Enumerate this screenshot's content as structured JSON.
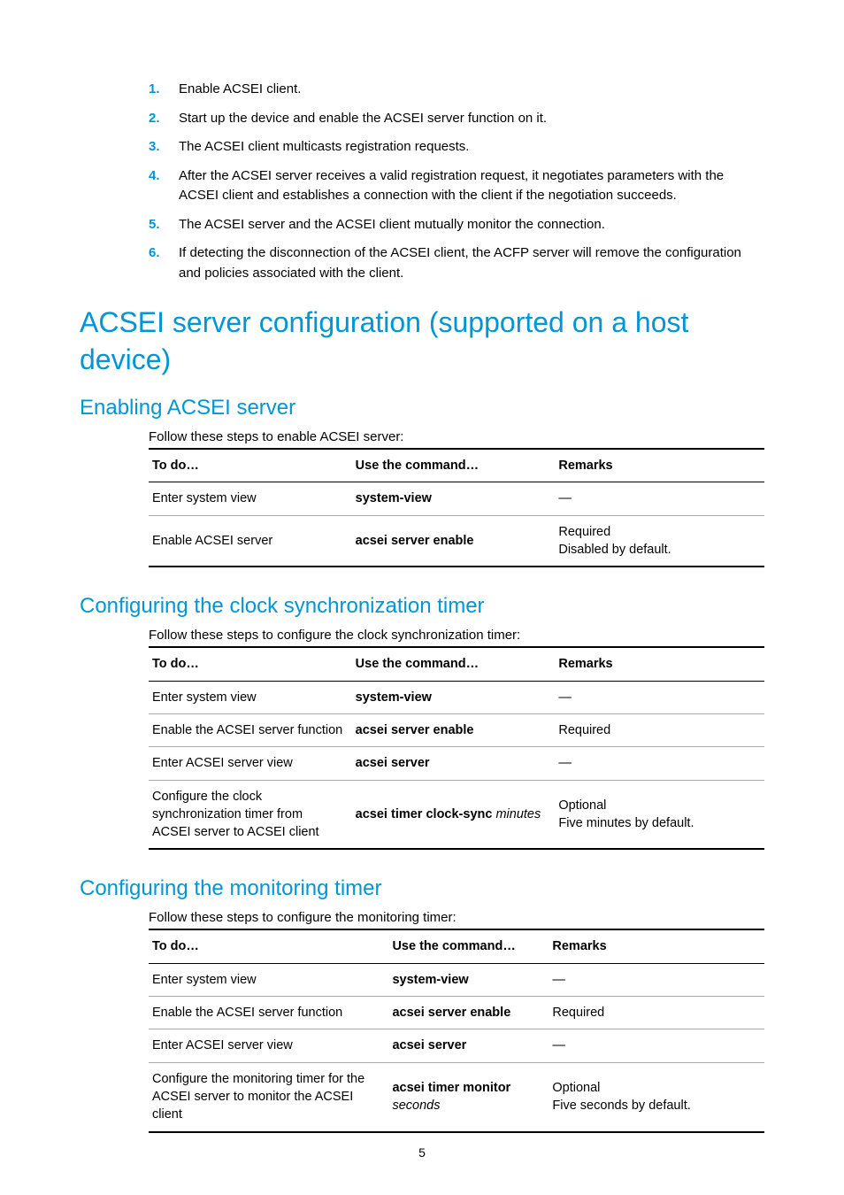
{
  "steps": [
    "Enable ACSEI client.",
    "Start up the device and enable the ACSEI server function on it.",
    "The ACSEI client multicasts registration requests.",
    "After the ACSEI server receives a valid registration request, it negotiates parameters with the ACSEI client and establishes a connection with the client if the negotiation succeeds.",
    "The ACSEI server and the ACSEI client mutually monitor the connection.",
    "If detecting the disconnection of the ACSEI client, the ACFP server will remove the configuration and policies associated with the client."
  ],
  "h1": "ACSEI server configuration (supported on a host device)",
  "sections": [
    {
      "h2": "Enabling ACSEI server",
      "intro": "Follow these steps to enable ACSEI server:",
      "headers": {
        "c1": "To do…",
        "c2": "Use the command…",
        "c3": "Remarks"
      },
      "rows": [
        {
          "c1": "Enter system view",
          "cmd_bold": "system-view",
          "cmd_ital": "",
          "c3": "—"
        },
        {
          "c1": "Enable ACSEI server",
          "cmd_bold": "acsei server enable",
          "cmd_ital": "",
          "c3": "Required\nDisabled by default."
        }
      ]
    },
    {
      "h2": "Configuring the clock synchronization timer",
      "intro": "Follow these steps to configure the clock synchronization timer:",
      "headers": {
        "c1": "To do…",
        "c2": "Use the command…",
        "c3": "Remarks"
      },
      "rows": [
        {
          "c1": "Enter system view",
          "cmd_bold": "system-view",
          "cmd_ital": "",
          "c3": "—"
        },
        {
          "c1": "Enable the ACSEI server function",
          "cmd_bold": "acsei server enable",
          "cmd_ital": "",
          "c3": "Required"
        },
        {
          "c1": "Enter ACSEI server view",
          "cmd_bold": "acsei server",
          "cmd_ital": "",
          "c3": "—"
        },
        {
          "c1": "Configure the clock synchronization timer from ACSEI server to ACSEI client",
          "cmd_bold": "acsei timer clock-sync",
          "cmd_ital": " minutes",
          "c3": "Optional\nFive minutes by default."
        }
      ]
    },
    {
      "h2": "Configuring the monitoring timer",
      "intro": "Follow these steps to configure the monitoring timer:",
      "headers": {
        "c1": "To do…",
        "c2": "Use the command…",
        "c3": "Remarks"
      },
      "rows": [
        {
          "c1": "Enter system view",
          "cmd_bold": "system-view",
          "cmd_ital": "",
          "c3": "—"
        },
        {
          "c1": "Enable the ACSEI server function",
          "cmd_bold": "acsei server enable",
          "cmd_ital": "",
          "c3": "Required"
        },
        {
          "c1": "Enter ACSEI server view",
          "cmd_bold": "acsei server",
          "cmd_ital": "",
          "c3": "—"
        },
        {
          "c1": "Configure the monitoring timer for the ACSEI server to monitor the ACSEI client",
          "cmd_bold": "acsei timer monitor",
          "cmd_ital": " seconds",
          "c3": "Optional\nFive seconds by default."
        }
      ]
    }
  ],
  "pagenum": "5",
  "col_widths": {
    "s0": {
      "c1": "33%",
      "c2": "33%",
      "c3": "34%"
    },
    "s1": {
      "c1": "33%",
      "c2": "33%",
      "c3": "34%"
    },
    "s2": {
      "c1": "39%",
      "c2": "26%",
      "c3": "35%"
    }
  }
}
